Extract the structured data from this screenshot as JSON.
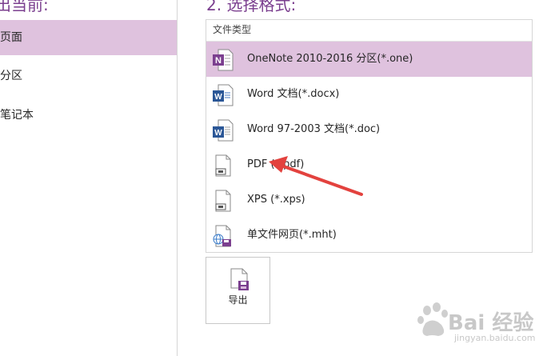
{
  "left": {
    "heading": "出当前:",
    "items": [
      {
        "label": "页面",
        "selected": true
      },
      {
        "label": "分区",
        "selected": false
      },
      {
        "label": "笔记本",
        "selected": false
      }
    ]
  },
  "right": {
    "heading": "2. 选择格式:",
    "list_header": "文件类型",
    "formats": [
      {
        "label": "OneNote 2010-2016 分区(*.one)",
        "icon": "onenote-icon",
        "selected": true
      },
      {
        "label": "Word 文档(*.docx)",
        "icon": "word-docx-icon",
        "selected": false
      },
      {
        "label": "Word 97-2003 文档(*.doc)",
        "icon": "word-doc-icon",
        "selected": false
      },
      {
        "label": "PDF (*.pdf)",
        "icon": "pdf-icon",
        "selected": false
      },
      {
        "label": "XPS (*.xps)",
        "icon": "xps-icon",
        "selected": false
      },
      {
        "label": "单文件网页(*.mht)",
        "icon": "mht-icon",
        "selected": false
      }
    ],
    "export_label": "导出"
  },
  "colors": {
    "accent": "#7b3f8f",
    "selection": "#dfc2de",
    "annotation_arrow": "#e3423e"
  },
  "watermark": {
    "brand": "Bai 经验",
    "url": "jingyan.baidu.com"
  }
}
